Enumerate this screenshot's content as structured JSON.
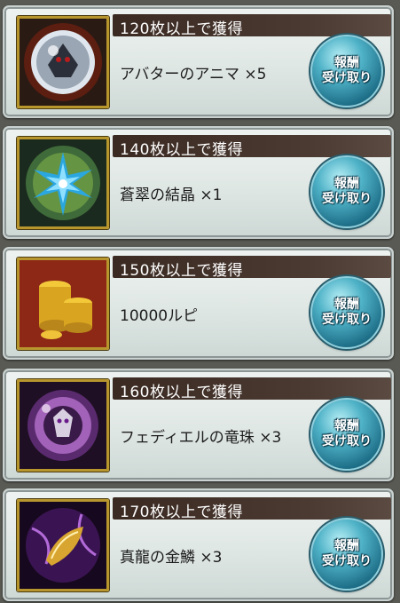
{
  "rewards": [
    {
      "header": "120枚以上で獲得",
      "item": "アバターのアニマ ×5",
      "icon": "anima-orb-icon",
      "button_line1": "報酬",
      "button_line2": "受け取り"
    },
    {
      "header": "140枚以上で獲得",
      "item": "蒼翠の結晶 ×1",
      "icon": "crystal-icon",
      "button_line1": "報酬",
      "button_line2": "受け取り"
    },
    {
      "header": "150枚以上で獲得",
      "item": "10000ルピ",
      "icon": "rupie-coins-icon",
      "button_line1": "報酬",
      "button_line2": "受け取り"
    },
    {
      "header": "160枚以上で獲得",
      "item": "フェディエルの竜珠 ×3",
      "icon": "dragon-orb-icon",
      "button_line1": "報酬",
      "button_line2": "受け取り"
    },
    {
      "header": "170枚以上で獲得",
      "item": "真龍の金鱗 ×3",
      "icon": "golden-scale-icon",
      "button_line1": "報酬",
      "button_line2": "受け取り"
    }
  ],
  "colors": {
    "header_bg": "#3a2a22",
    "button": "#1e6f88",
    "frame_gold": "#b8962e"
  }
}
